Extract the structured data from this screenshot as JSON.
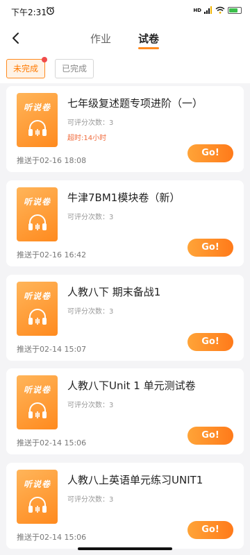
{
  "status_bar": {
    "time": "下午2:31",
    "network": "HD",
    "battery": "94"
  },
  "nav": {
    "tabs": [
      {
        "label": "作业"
      },
      {
        "label": "试卷"
      }
    ],
    "active_tab": "试卷"
  },
  "filters": [
    {
      "label": "未完成",
      "active": true
    },
    {
      "label": "已完成",
      "active": false
    }
  ],
  "cover_label": "听说卷",
  "go_label": "Go!",
  "cards": [
    {
      "title": "七年级复述题专项进阶（一）",
      "meta": "可评分次数：3",
      "deadline": "超时:14小时",
      "pushed": "推送于02-16 18:08"
    },
    {
      "title": "牛津7BM1模块卷（新）",
      "meta": "可评分次数：3",
      "pushed": "推送于02-16 16:42"
    },
    {
      "title": "人教八下 期末备战1",
      "meta": "可评分次数：3",
      "pushed": "推送于02-14 15:07"
    },
    {
      "title": "人教八下Unit 1 单元测试卷",
      "meta": "可评分次数：3",
      "pushed": "推送于02-14 15:06"
    },
    {
      "title": "人教八上英语单元练习UNIT1",
      "meta": "可评分次数：3",
      "pushed": "推送于02-14 15:06"
    }
  ],
  "colors": {
    "accent": "#ff8a1e",
    "deadline": "#f06a3b",
    "background": "#f4f4f6"
  }
}
